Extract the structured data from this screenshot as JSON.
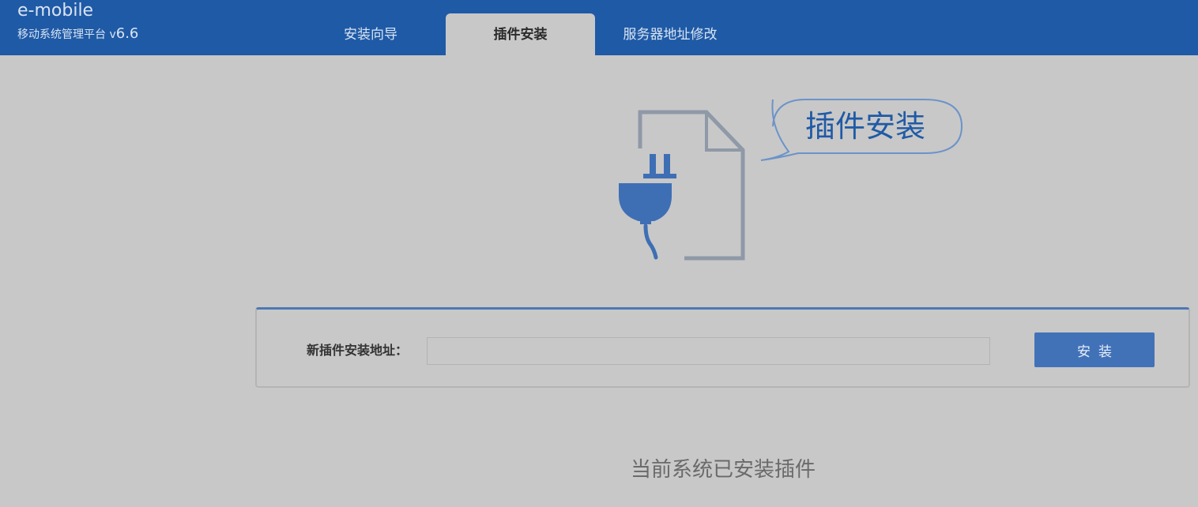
{
  "header": {
    "brand_title": "e-mobile",
    "brand_subtitle": "移动系统管理平台 v",
    "brand_version": "6.6",
    "tabs": [
      {
        "label": "安装向导"
      },
      {
        "label": "插件安装",
        "active": true
      },
      {
        "label": "服务器地址修改"
      }
    ]
  },
  "hero": {
    "title": "插件安装",
    "icon": "plug-document-icon"
  },
  "install_panel": {
    "label": "新插件安装地址：",
    "input_value": "",
    "button_label": "安装"
  },
  "installed_section": {
    "title": "当前系统已安装插件"
  },
  "colors": {
    "header_bg": "#1f5aa6",
    "page_bg": "#c8c8c8",
    "accent": "#4172b8"
  }
}
